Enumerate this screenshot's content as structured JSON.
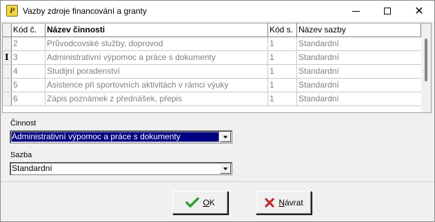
{
  "window": {
    "title": "Vazby zdroje financování a granty",
    "app_icon_glyph": "P",
    "controls": [
      "minimize-icon",
      "maximize-icon",
      "close-icon"
    ]
  },
  "grid": {
    "columns": [
      "Kód č.",
      "Název činnosti",
      "Kód s.",
      "Název sazby"
    ],
    "current_row_marker": "I",
    "rows": [
      {
        "kod": "2",
        "nazev": "Průvodcovské služby, doprovod",
        "kod_s": "1",
        "sazba": "Standardní"
      },
      {
        "kod": "3",
        "nazev": "Administrativní výpomoc a práce s dokumenty",
        "kod_s": "1",
        "sazba": "Standardní"
      },
      {
        "kod": "4",
        "nazev": "Studijní poradenství",
        "kod_s": "1",
        "sazba": "Standardní"
      },
      {
        "kod": "5",
        "nazev": "Asistence při sportovních aktivitách v rámci výuky",
        "kod_s": "1",
        "sazba": "Standardní"
      },
      {
        "kod": "6",
        "nazev": "Zápis poznámek z přednášek, přepis",
        "kod_s": "1",
        "sazba": "Standardní"
      }
    ]
  },
  "form": {
    "cinnost_label": "Činnost",
    "cinnost_value": "Administrativní výpomoc a práce s dokumenty",
    "sazba_label": "Sazba",
    "sazba_value": "Standardní"
  },
  "buttons": {
    "ok_label_first": "O",
    "ok_label_rest": "K",
    "back_label_first": "N",
    "back_label_rest": "ávrat",
    "ok_icon": "check-icon",
    "back_icon": "x-icon"
  },
  "colors": {
    "selection": "#000080",
    "ok_icon": "#2e9e2e",
    "back_icon": "#c0282a"
  }
}
